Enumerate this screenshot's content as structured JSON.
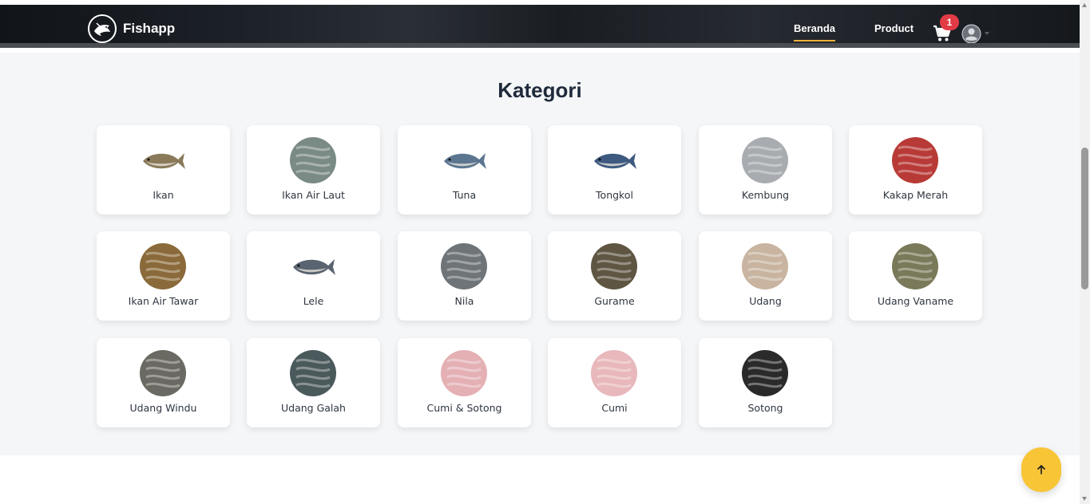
{
  "navbar": {
    "brand": "Fishapp",
    "links": [
      {
        "label": "Beranda",
        "active": true
      },
      {
        "label": "Product",
        "active": false
      }
    ],
    "cart_count": "1",
    "accent": "#f6b23a",
    "badge_color": "#e23b46"
  },
  "section": {
    "title": "Kategori"
  },
  "categories": [
    {
      "label": "Ikan",
      "icon": "fish-photo",
      "color": "#8a7a5a"
    },
    {
      "label": "Ikan Air Laut",
      "icon": "sea-fish-photo",
      "color": "#7a8a84"
    },
    {
      "label": "Tuna",
      "icon": "tuna-photo",
      "color": "#5c7690"
    },
    {
      "label": "Tongkol",
      "icon": "tongkol-photo",
      "color": "#3e5a80"
    },
    {
      "label": "Kembung",
      "icon": "kembung-photo",
      "color": "#a8acb0"
    },
    {
      "label": "Kakap Merah",
      "icon": "red-snapper-photo",
      "color": "#b83a36"
    },
    {
      "label": "Ikan Air Tawar",
      "icon": "freshwater-fish-photo",
      "color": "#8a6a3a"
    },
    {
      "label": "Lele",
      "icon": "catfish-photo",
      "color": "#5a6470"
    },
    {
      "label": "Nila",
      "icon": "tilapia-photo",
      "color": "#6e7478"
    },
    {
      "label": "Gurame",
      "icon": "gourami-photo",
      "color": "#5e5642"
    },
    {
      "label": "Udang",
      "icon": "shrimp-photo",
      "color": "#c8b4a0"
    },
    {
      "label": "Udang Vaname",
      "icon": "vaname-shrimp-photo",
      "color": "#7a7a5a"
    },
    {
      "label": "Udang Windu",
      "icon": "tiger-prawn-photo",
      "color": "#6a6a62"
    },
    {
      "label": "Udang Galah",
      "icon": "river-prawn-photo",
      "color": "#4a5a5c"
    },
    {
      "label": "Cumi & Sotong",
      "icon": "squid-cuttlefish-photo",
      "color": "#e4b0b4"
    },
    {
      "label": "Cumi",
      "icon": "squid-photo",
      "color": "#e8b8bc"
    },
    {
      "label": "Sotong",
      "icon": "cuttlefish-photo",
      "color": "#2a2a2a"
    }
  ],
  "back_to_top": {
    "icon": "arrow-up-icon",
    "color": "#f8c537"
  }
}
